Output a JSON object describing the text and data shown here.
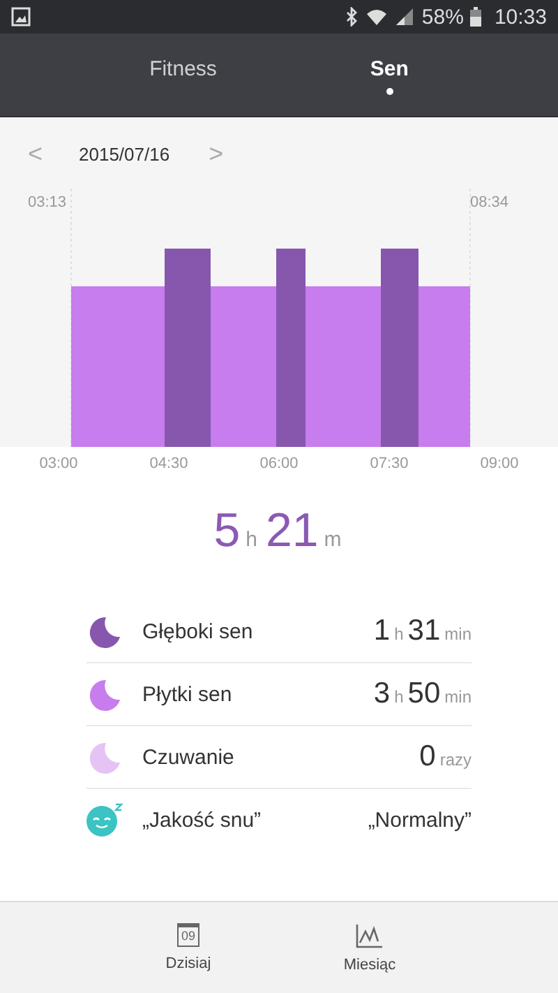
{
  "status_bar": {
    "battery": "58%",
    "time": "10:33"
  },
  "tabs": [
    {
      "label": "Fitness",
      "selected": false
    },
    {
      "label": "Sen",
      "selected": true
    }
  ],
  "date_nav": {
    "prev": "<",
    "date": "2015/07/16",
    "next": ">"
  },
  "sleep_chart": {
    "start_label": "03:13",
    "end_label": "08:34",
    "axis_labels": [
      "03:00",
      "04:30",
      "06:00",
      "07:30",
      "09:00"
    ]
  },
  "total": {
    "hours": "5",
    "hours_unit": "h",
    "minutes": "21",
    "minutes_unit": "m"
  },
  "stats": [
    {
      "kind": "deep",
      "label": "Głęboki sen",
      "parts": [
        {
          "value": "1",
          "unit": "h"
        },
        {
          "value": "31",
          "unit": "min"
        }
      ]
    },
    {
      "kind": "light",
      "label": "Płytki sen",
      "parts": [
        {
          "value": "3",
          "unit": "h"
        },
        {
          "value": "50",
          "unit": "min"
        }
      ]
    },
    {
      "kind": "awake",
      "label": "Czuwanie",
      "parts": [
        {
          "value": "0",
          "unit": "razy"
        }
      ]
    },
    {
      "kind": "quality",
      "label": "„Jakość snu”",
      "text": "„Normalny”"
    }
  ],
  "bottom_nav": [
    {
      "label": "Dzisiaj",
      "kind": "calendar",
      "icon_text": "09"
    },
    {
      "label": "Miesiąc",
      "kind": "chart"
    }
  ]
}
